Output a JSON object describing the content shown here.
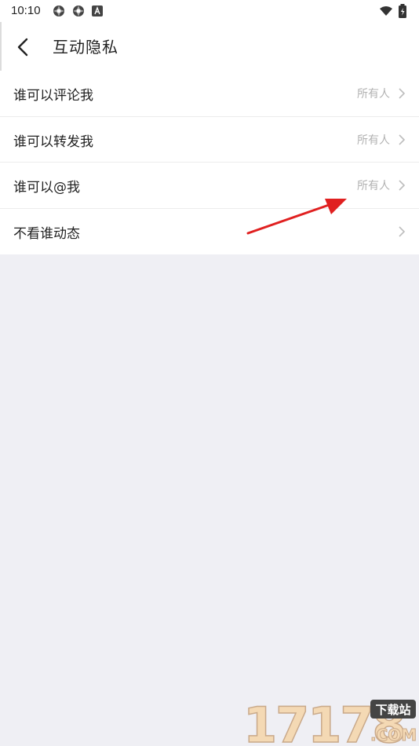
{
  "status_bar": {
    "time": "10:10",
    "icons": [
      "app-icon",
      "app-icon",
      "app-icon",
      "wifi-icon",
      "battery-icon"
    ]
  },
  "header": {
    "title": "互动隐私",
    "back_icon": "chevron-left-icon"
  },
  "settings": [
    {
      "label": "谁可以评论我",
      "value": "所有人"
    },
    {
      "label": "谁可以转发我",
      "value": "所有人"
    },
    {
      "label": "谁可以@我",
      "value": "所有人"
    },
    {
      "label": "不看谁动态",
      "value": ""
    }
  ],
  "annotation": {
    "type": "red-arrow",
    "color": "#e02020"
  },
  "watermark": {
    "number": "17178",
    "badge": "下载站",
    "domain": ".COM"
  },
  "colors": {
    "background": "#efeff4",
    "surface": "#ffffff",
    "text": "#222222",
    "muted": "#b2b2b2",
    "divider": "#ececec"
  }
}
